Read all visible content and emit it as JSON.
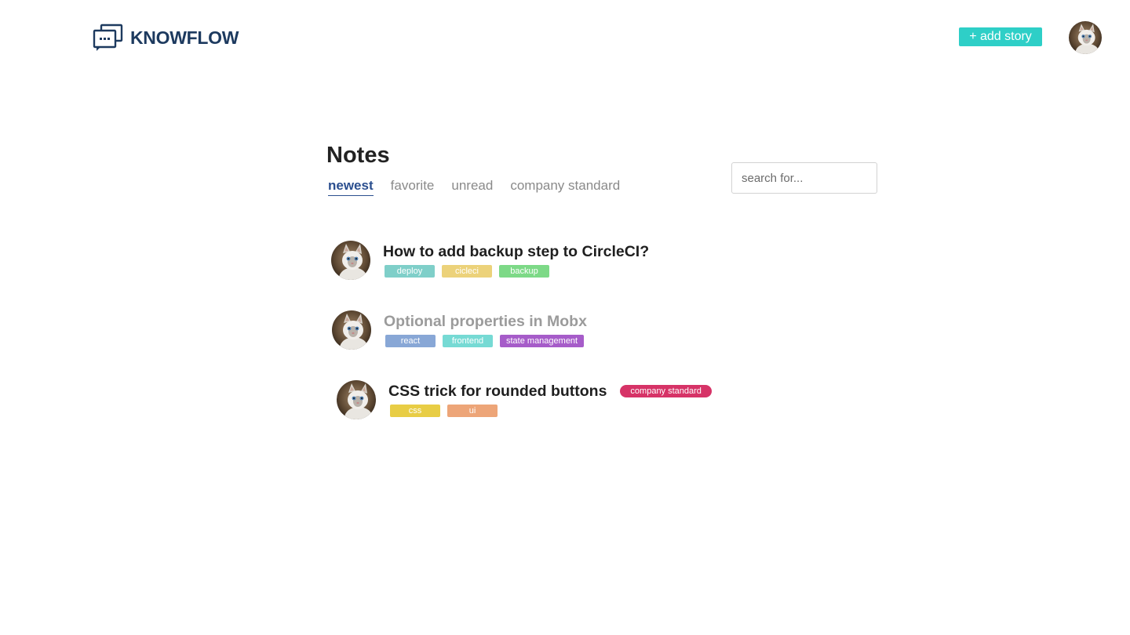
{
  "brand": {
    "name": "KNOWFLOW",
    "icon": "chat-bubbles-icon",
    "color": "#1d3a5f"
  },
  "header": {
    "add_story_label": "+ add story",
    "add_story_color": "#2ecfc7",
    "user_avatar": "cat-avatar"
  },
  "notes_page": {
    "title": "Notes",
    "tabs": [
      {
        "label": "newest",
        "active": true
      },
      {
        "label": "favorite",
        "active": false
      },
      {
        "label": "unread",
        "active": false
      },
      {
        "label": "company standard",
        "active": false
      }
    ],
    "search": {
      "placeholder": "search for...",
      "value": ""
    },
    "active_tab_color": "#2b4f8f"
  },
  "notes": [
    {
      "title": "How to add backup step to CircleCI?",
      "read": false,
      "badge": "",
      "tags": [
        {
          "label": "deploy",
          "color": "#7fcfc9"
        },
        {
          "label": "cicleci",
          "color": "#ecd27a"
        },
        {
          "label": "backup",
          "color": "#7dd987"
        }
      ]
    },
    {
      "title": "Optional properties in Mobx",
      "read": true,
      "badge": "",
      "tags": [
        {
          "label": "react",
          "color": "#88a7d6"
        },
        {
          "label": "frontend",
          "color": "#76dad4"
        },
        {
          "label": "state management",
          "color": "#a65cc9"
        }
      ]
    },
    {
      "title": "CSS trick for rounded buttons",
      "read": false,
      "badge": "company standard",
      "badge_color": "#d63367",
      "tags": [
        {
          "label": "css",
          "color": "#e8cd45"
        },
        {
          "label": "ui",
          "color": "#eda578"
        }
      ]
    }
  ]
}
